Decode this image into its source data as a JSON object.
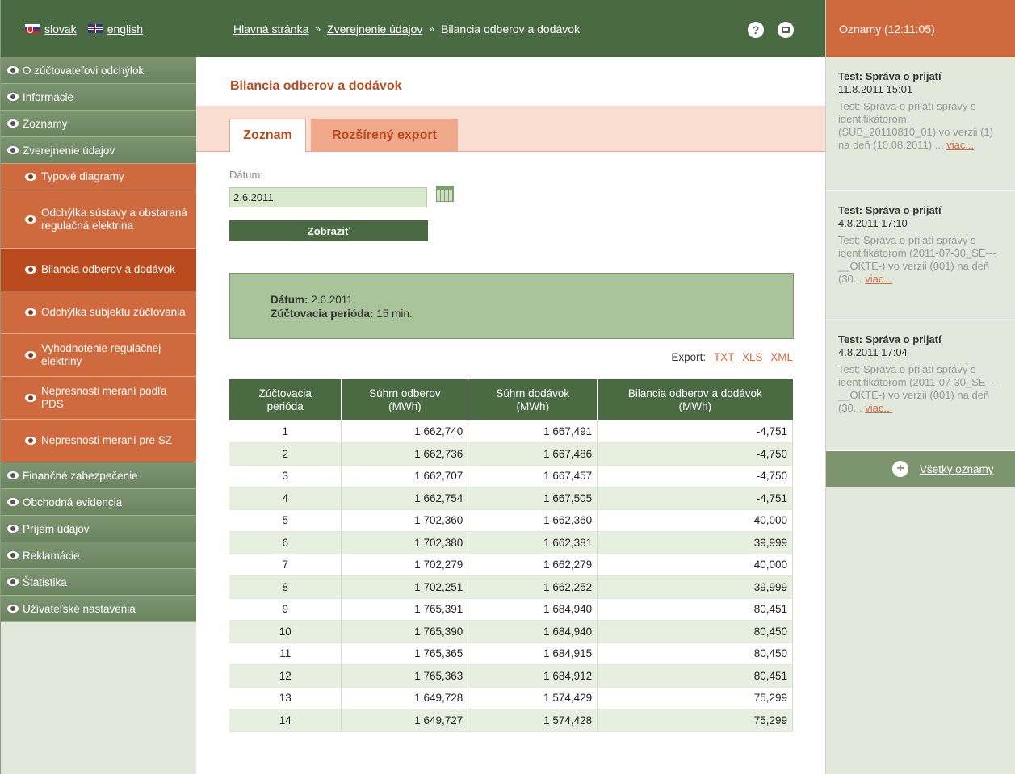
{
  "lang": {
    "slovak": "slovak",
    "english": "english"
  },
  "nav": [
    {
      "label": "O zúčtovateľovi odchýlok",
      "type": "main"
    },
    {
      "label": "Informácie",
      "type": "main"
    },
    {
      "label": "Zoznamy",
      "type": "main"
    },
    {
      "label": "Zverejnenie údajov",
      "type": "main"
    },
    {
      "label": "Typové diagramy",
      "type": "sub"
    },
    {
      "label": "Odchýlka sústavy a obstaraná regulačná elektrina",
      "type": "sub"
    },
    {
      "label": "Bilancia odberov a dodávok",
      "type": "sub",
      "active": true
    },
    {
      "label": "Odchýlka subjektu zúčtovania",
      "type": "sub"
    },
    {
      "label": "Vyhodnotenie regulačnej elektriny",
      "type": "sub"
    },
    {
      "label": "Nepresnosti meraní podľa PDS",
      "type": "sub"
    },
    {
      "label": "Nepresnosti meraní pre SZ",
      "type": "sub"
    },
    {
      "label": "Finančné zabezpečenie",
      "type": "main"
    },
    {
      "label": "Obchodná evidencia",
      "type": "main"
    },
    {
      "label": "Príjem údajov",
      "type": "main"
    },
    {
      "label": "Reklamácie",
      "type": "main"
    },
    {
      "label": "Štatistika",
      "type": "main"
    },
    {
      "label": "Užívateľské nastavenia",
      "type": "main"
    }
  ],
  "breadcrumb": {
    "home": "Hlavná stránka",
    "section": "Zverejnenie údajov",
    "current": "Bilancia odberov a dodávok",
    "sep": "»"
  },
  "page_title": "Bilancia odberov a dodávok",
  "tabs": {
    "list": "Zoznam",
    "export": "Rozšírený export"
  },
  "form": {
    "date_label": "Dátum:",
    "date_value": "2.6.2011",
    "show_button": "Zobraziť"
  },
  "info": {
    "date_label": "Dátum:",
    "date_value": "2.6.2011",
    "period_label": "Zúčtovacia perióda:",
    "period_value": "15 min."
  },
  "export": {
    "label": "Export:",
    "txt": "TXT",
    "xls": "XLS",
    "xml": "XML"
  },
  "table": {
    "headers": [
      [
        "Zúčtovacia",
        "perióda"
      ],
      [
        "Súhrn odberov",
        "(MWh)"
      ],
      [
        "Súhrn dodávok",
        "(MWh)"
      ],
      [
        "Bilancia odberov a dodávok",
        "(MWh)"
      ]
    ],
    "rows": [
      [
        "1",
        "1 662,740",
        "1 667,491",
        "-4,751"
      ],
      [
        "2",
        "1 662,736",
        "1 667,486",
        "-4,750"
      ],
      [
        "3",
        "1 662,707",
        "1 667,457",
        "-4,750"
      ],
      [
        "4",
        "1 662,754",
        "1 667,505",
        "-4,751"
      ],
      [
        "5",
        "1 702,360",
        "1 662,360",
        "40,000"
      ],
      [
        "6",
        "1 702,380",
        "1 662,381",
        "39,999"
      ],
      [
        "7",
        "1 702,279",
        "1 662,279",
        "40,000"
      ],
      [
        "8",
        "1 702,251",
        "1 662,252",
        "39,999"
      ],
      [
        "9",
        "1 765,391",
        "1 684,940",
        "80,451"
      ],
      [
        "10",
        "1 765,390",
        "1 684,940",
        "80,450"
      ],
      [
        "11",
        "1 765,365",
        "1 684,915",
        "80,450"
      ],
      [
        "12",
        "1 765,363",
        "1 684,912",
        "80,451"
      ],
      [
        "13",
        "1 649,728",
        "1 574,429",
        "75,299"
      ],
      [
        "14",
        "1 649,727",
        "1 574,428",
        "75,299"
      ]
    ]
  },
  "news": {
    "header": "Oznamy (12:11:05)",
    "items": [
      {
        "title": "Test: Správa o prijatí",
        "date": "11.8.2011 15:01",
        "body": "Test: Správa o prijatí správy s identifikátorom (SUB_20110810_01) vo verzii (1) na deň (10.08.2011) ...",
        "more": "viac..."
      },
      {
        "title": "Test: Správa o prijatí",
        "date": "4.8.2011 17:10",
        "body": "Test: Správa o prijatí správy s identifikátorom (2011-07-30_SE---__OKTE-) vo verzii (001) na deň (30...",
        "more": "viac..."
      },
      {
        "title": "Test: Správa o prijatí",
        "date": "4.8.2011 17:04",
        "body": "Test: Správa o prijatí správy s identifikátorom (2011-07-30_SE---__OKTE-) vo verzii (001) na deň (30...",
        "more": "viac..."
      }
    ],
    "all": "Všetky oznamy",
    "plus": "+"
  },
  "icons": {
    "help": "?"
  },
  "colors": {
    "green_dark": "#4a6a44",
    "orange": "#cf6a3f",
    "orange_active": "#b84a1e"
  }
}
